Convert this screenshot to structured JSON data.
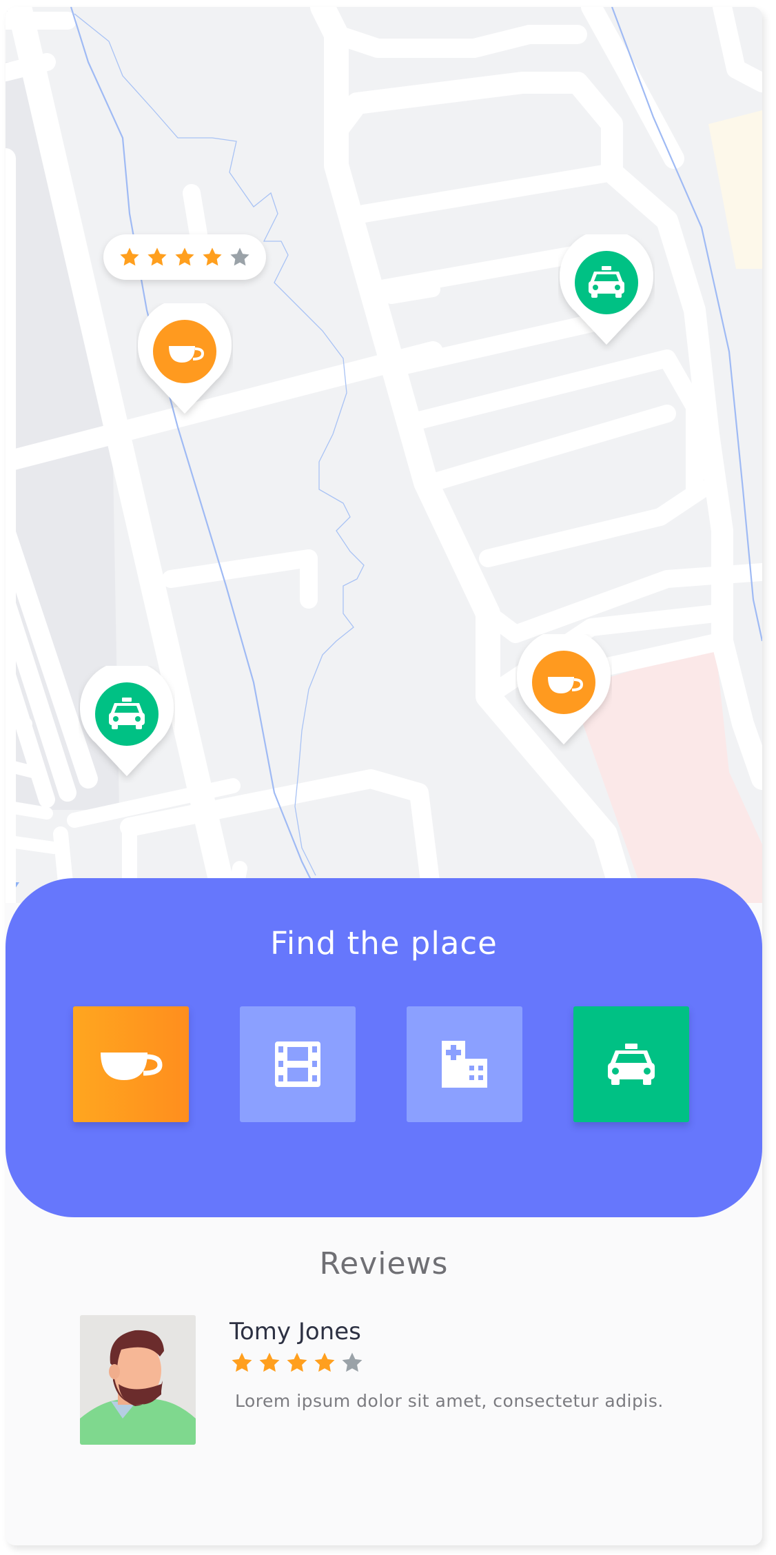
{
  "map": {
    "rating_stars": {
      "filled": 4,
      "total": 5
    },
    "pins": [
      {
        "type": "coffee",
        "icon": "coffee-cup-icon",
        "color": "#ff9a1f"
      },
      {
        "type": "taxi",
        "icon": "taxi-icon",
        "color": "#00c184"
      },
      {
        "type": "coffee",
        "icon": "coffee-cup-icon",
        "color": "#ff9a1f"
      },
      {
        "type": "taxi",
        "icon": "taxi-icon",
        "color": "#00c184"
      }
    ]
  },
  "panel": {
    "title": "Find the place",
    "categories": [
      {
        "id": "coffee",
        "icon": "coffee-cup-icon",
        "selected": true,
        "color": "#ff9a1f"
      },
      {
        "id": "cinema",
        "icon": "film-strip-icon",
        "selected": false,
        "color": "#8ba0ff"
      },
      {
        "id": "hospital",
        "icon": "hospital-building-icon",
        "selected": false,
        "color": "#8ba0ff"
      },
      {
        "id": "taxi",
        "icon": "taxi-icon",
        "selected": true,
        "color": "#00c184"
      }
    ],
    "background": "#6677fc"
  },
  "reviews": {
    "title": "Reviews",
    "items": [
      {
        "name": "Tomy Jones",
        "rating": 4,
        "rating_max": 5,
        "text": "Lorem ipsum dolor sit amet, consectetur adipis."
      }
    ]
  },
  "colors": {
    "star_filled": "#ff9f1e",
    "star_empty": "#9aa2a8",
    "accent": "#6677fc"
  }
}
